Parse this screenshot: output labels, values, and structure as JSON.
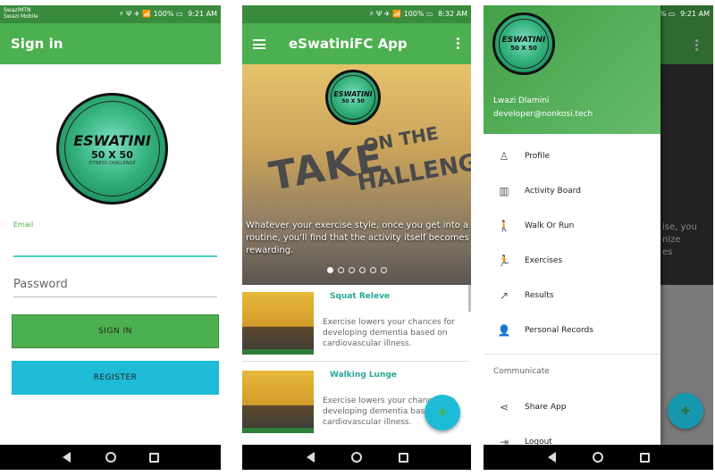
{
  "status": {
    "carrier_line1": "SwaziMTN",
    "carrier_line2": "Swazi Mobile",
    "icons": "⚡ Ψ ✈ 📶 100%",
    "battery": "▭",
    "time1": "9:21 AM",
    "time2": "8:32 AM",
    "time3": "9:21 AM"
  },
  "signin": {
    "title": "Sign in",
    "logo_line1": "ESWATINI",
    "logo_line2": "50 X 50",
    "logo_line3": "FITNESS CHALLENGE",
    "email_label": "Email",
    "password_placeholder": "Password",
    "signin_button": "SIGN IN",
    "register_button": "REGISTER"
  },
  "home": {
    "title": "eSwatiniFC App",
    "menu_icon": "hamburger-icon",
    "overflow_icon": "more-vert-icon",
    "hero_word1": "TAKE",
    "hero_word2": "ON THE",
    "hero_word3": "HALLENGE",
    "hero_caption": "Whatever your exercise style, once you get into a routine, you'll find that the activity itself becomes rewarding.",
    "carousel_count": 6,
    "carousel_active": 0,
    "cards": [
      {
        "title": "Squat Releve",
        "description": "Exercise lowers your chances for developing dementia based on cardiovascular illness."
      },
      {
        "title": "Walking Lunge",
        "description": "Exercise lowers your chances for developing dementia based on cardiovascular illness."
      }
    ],
    "fab_icon": "add-icon"
  },
  "drawer": {
    "user_name": "Lwazi Dlamini",
    "user_email": "developer@nonkosi.tech",
    "items": [
      {
        "label": "Profile",
        "icon": "person-icon",
        "glyph": "♙"
      },
      {
        "label": "Activity Board",
        "icon": "barcode-icon",
        "glyph": "▥"
      },
      {
        "label": "Walk Or Run",
        "icon": "walk-icon",
        "glyph": "🚶"
      },
      {
        "label": "Exercises",
        "icon": "exercise-icon",
        "glyph": "🏃"
      },
      {
        "label": "Results",
        "icon": "trending-icon",
        "glyph": "↗"
      },
      {
        "label": "Personal Records",
        "icon": "account-icon",
        "glyph": "👤"
      }
    ],
    "section_label": "Communicate",
    "share_label": "Share App",
    "share_glyph": "⋖",
    "logout_label": "Logout",
    "logout_glyph": "⇥",
    "background_text_line1": "ise, you",
    "background_text_line2": "nize",
    "background_text_line3": "es"
  },
  "colors": {
    "primary": "#4caf50",
    "primary_dark": "#3a8b3d",
    "accent": "#1ebbd7"
  }
}
